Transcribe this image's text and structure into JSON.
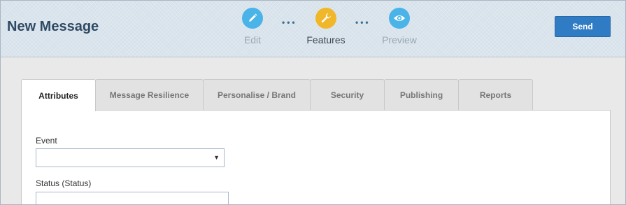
{
  "header": {
    "title": "New Message",
    "steps": [
      {
        "label": "Edit",
        "icon": "pencil-icon",
        "color": "#4ab3e8",
        "state": "inactive"
      },
      {
        "label": "Features",
        "icon": "wrench-icon",
        "color": "#f1b72b",
        "state": "active"
      },
      {
        "label": "Preview",
        "icon": "eye-icon",
        "color": "#4ab3e8",
        "state": "inactive"
      }
    ],
    "separator": "•••",
    "send_label": "Send"
  },
  "tabs": [
    {
      "label": "Attributes",
      "active": true
    },
    {
      "label": "Message Resilience",
      "active": false
    },
    {
      "label": "Personalise / Brand",
      "active": false
    },
    {
      "label": "Security",
      "active": false
    },
    {
      "label": "Publishing",
      "active": false
    },
    {
      "label": "Reports",
      "active": false
    }
  ],
  "form": {
    "event": {
      "label": "Event",
      "value": ""
    },
    "status": {
      "label": "Status (Status)",
      "value": ""
    }
  },
  "colors": {
    "accent": "#2f7bc4",
    "title": "#2e4a63"
  }
}
